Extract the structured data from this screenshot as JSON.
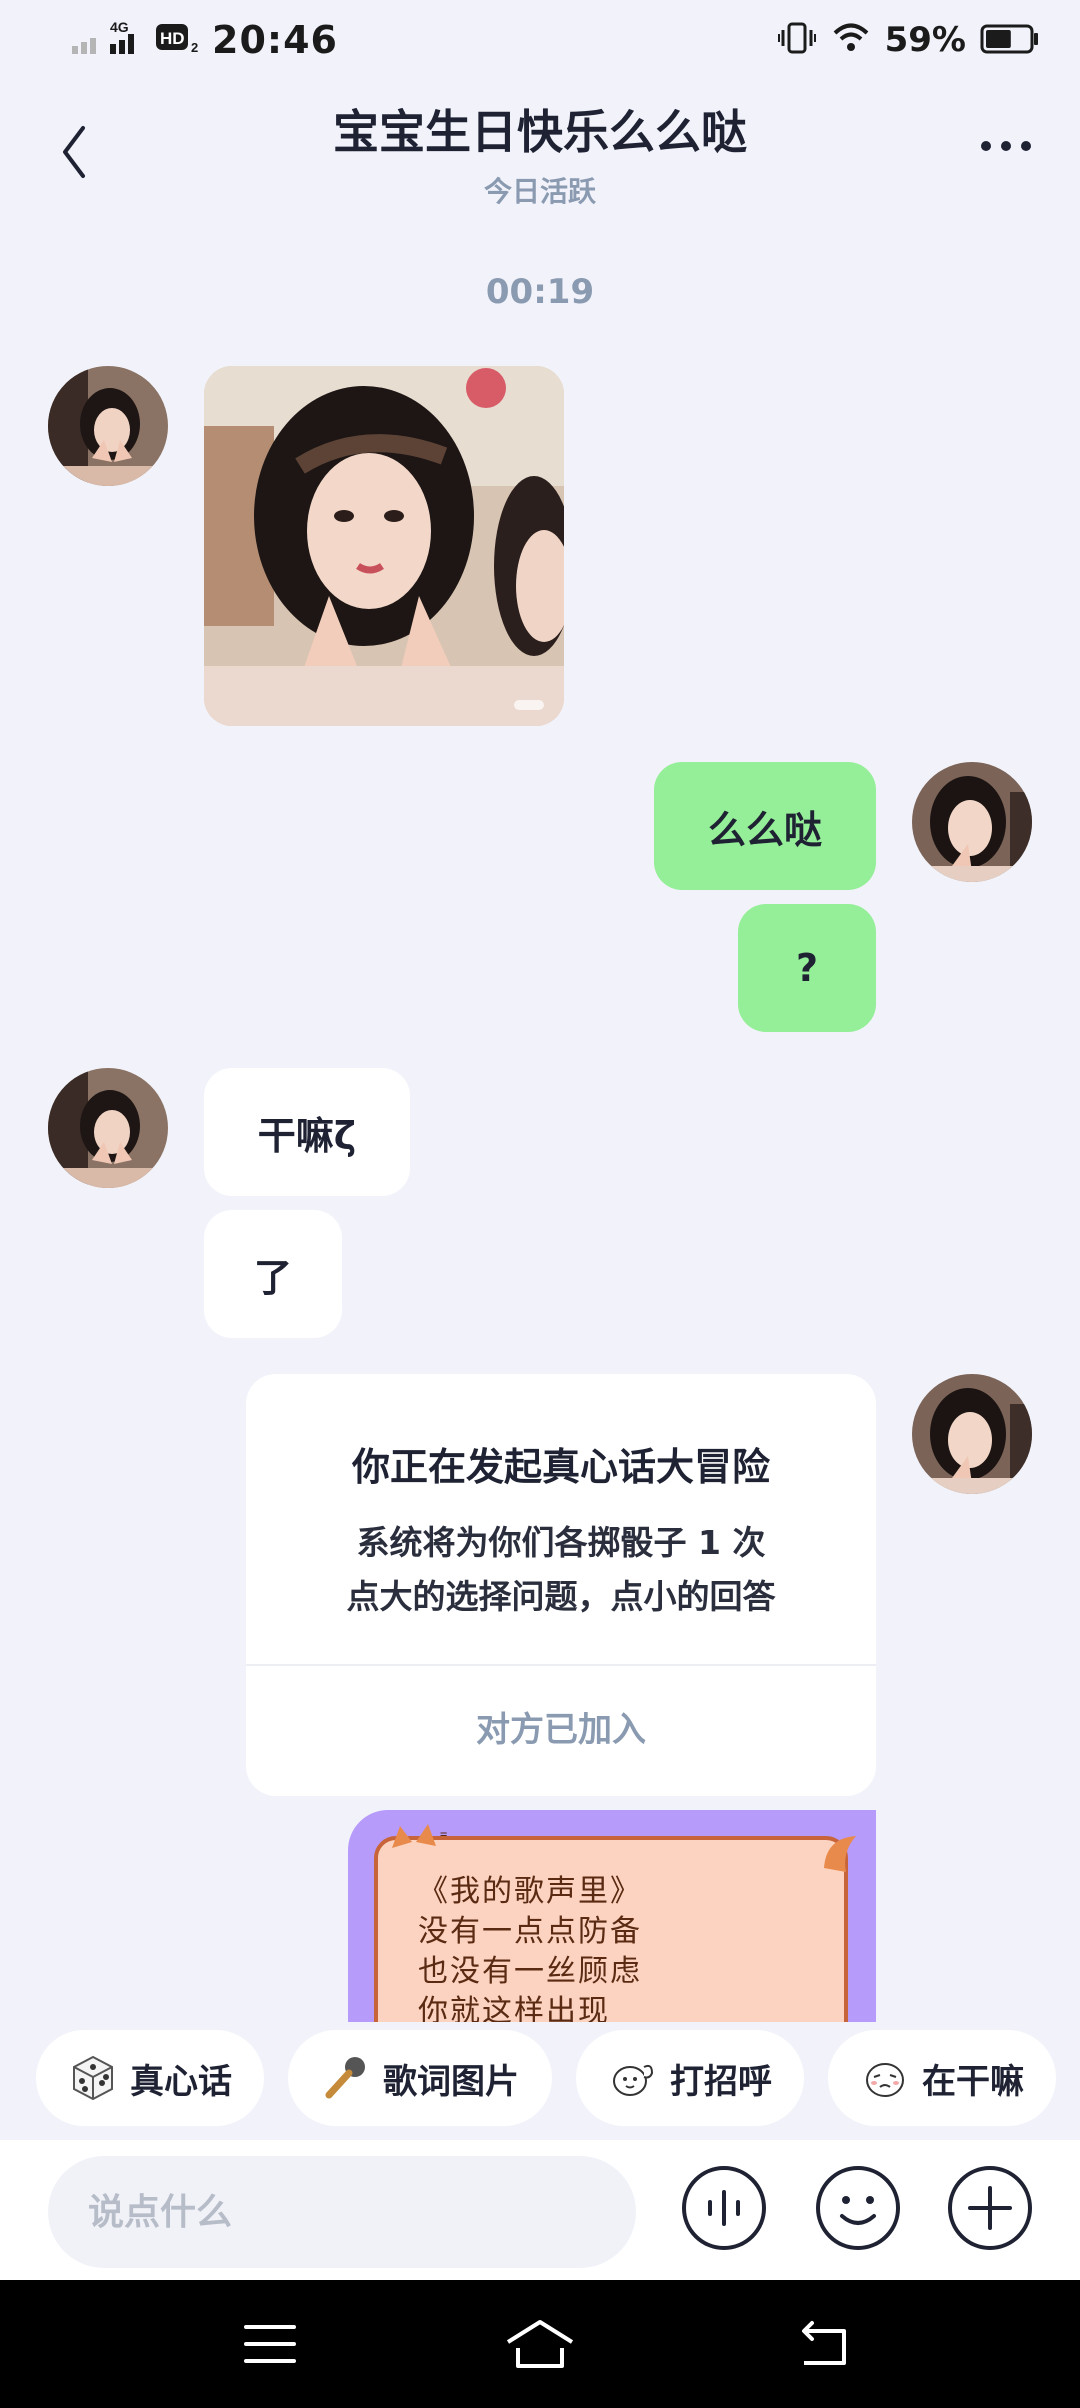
{
  "status_bar": {
    "network": "4G",
    "hd_badge": "HD",
    "hd_sub": "2",
    "time": "20:46",
    "battery_percent": "59%",
    "battery_level": 0.59
  },
  "header": {
    "title": "宝宝生日快乐么么哒",
    "subtitle": "今日活跃"
  },
  "chat": {
    "timestamp": "00:19",
    "messages": [
      {
        "from": "them",
        "type": "image"
      },
      {
        "from": "me",
        "type": "text",
        "text": "么么哒"
      },
      {
        "from": "me",
        "type": "text",
        "text": "?"
      },
      {
        "from": "them",
        "type": "text",
        "text": "干嘛ζ"
      },
      {
        "from": "them",
        "type": "text",
        "text": "了"
      }
    ],
    "game_card": {
      "title": "你正在发起真心话大冒险",
      "line1": "系统将为你们各掷骰子 1 次",
      "line2": "点大的选择问题，点小的回答",
      "status": "对方已加入"
    },
    "lyric_card": {
      "lines": [
        "《我的歌声里》",
        "没有一点点防备",
        "也没有一丝顾虑",
        "你就这样出现"
      ]
    }
  },
  "quick_actions": [
    {
      "label": "真心话",
      "icon": "dice-icon"
    },
    {
      "label": "歌词图片",
      "icon": "microphone-icon"
    },
    {
      "label": "打招呼",
      "icon": "wave-sticker-icon"
    },
    {
      "label": "在干嘛",
      "icon": "face-sticker-icon"
    }
  ],
  "input": {
    "placeholder": "说点什么"
  },
  "colors": {
    "background": "#f2f3fa",
    "my_bubble": "#95ee98",
    "their_bubble": "#ffffff",
    "muted_text": "#8a9ab0",
    "lyric_frame": "#b79bfa",
    "lyric_paper": "#fcd3c0"
  }
}
